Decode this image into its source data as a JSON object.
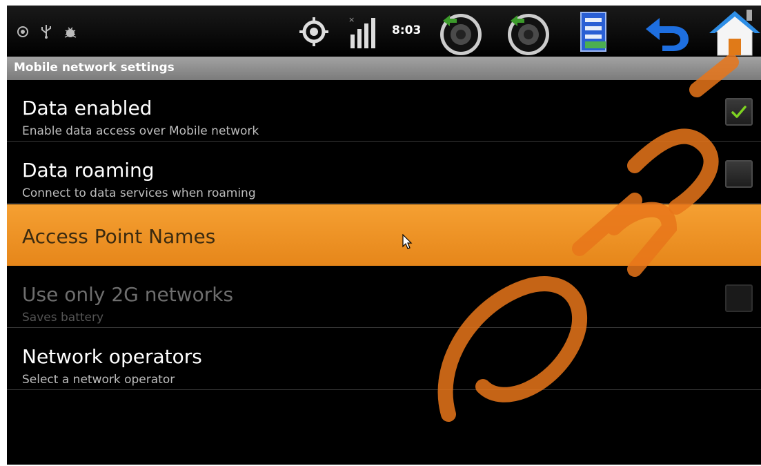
{
  "status_bar": {
    "time": "8:03",
    "left_icons": [
      "android-icon",
      "usb-icon",
      "debug-bug-icon"
    ],
    "right_icons": [
      "gps-icon",
      "signal-icon",
      "volume-down-icon",
      "volume-up-icon",
      "menu-icon",
      "back-icon",
      "home-icon"
    ]
  },
  "title_bar": {
    "title": "Mobile network settings"
  },
  "settings": [
    {
      "title": "Data enabled",
      "summary": "Enable data access over Mobile network",
      "checked": true,
      "enabled": true
    },
    {
      "title": "Data roaming",
      "summary": "Connect to data services when roaming",
      "checked": false,
      "enabled": true
    },
    {
      "title": "Access Point Names",
      "highlighted": true
    },
    {
      "title": "Use only 2G networks",
      "summary": "Saves battery",
      "checked": false,
      "enabled": false
    },
    {
      "title": "Network operators",
      "summary": "Select a network operator"
    }
  ],
  "colors": {
    "highlight": "#f0961e",
    "check": "#7ed321",
    "background": "#000000"
  }
}
